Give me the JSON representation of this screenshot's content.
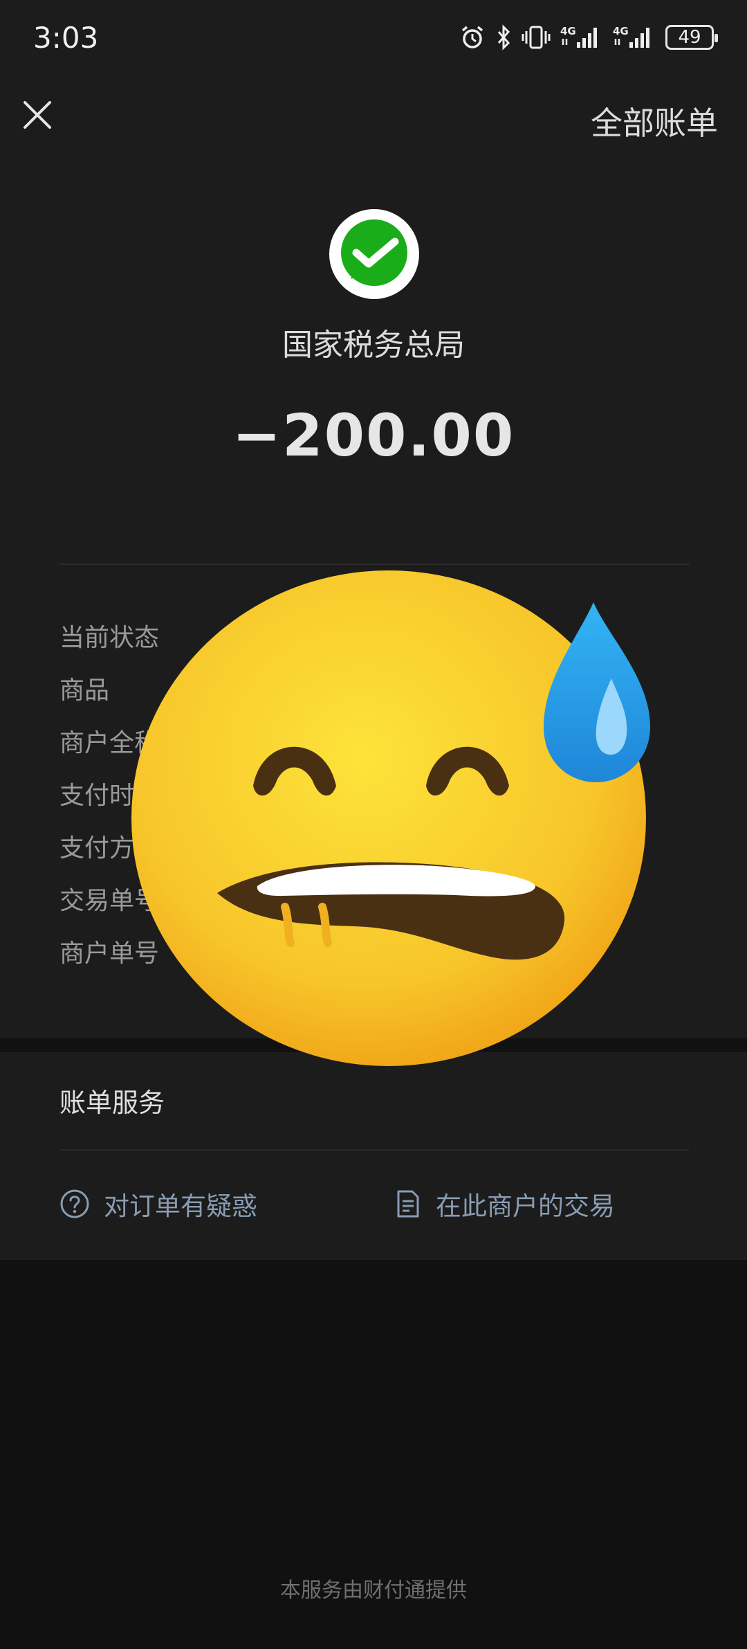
{
  "status_bar": {
    "time": "3:03",
    "battery": "49",
    "icons": [
      "alarm-icon",
      "bluetooth-icon",
      "vibrate-icon",
      "signal-4g-icon",
      "signal-4g-icon",
      "battery-icon"
    ]
  },
  "header": {
    "close_icon": "close-icon",
    "all_bills_label": "全部账单"
  },
  "merchant": {
    "logo_icon": "wechat-pay-icon",
    "name": "国家税务总局",
    "amount": "−200.00"
  },
  "details": {
    "rows": [
      {
        "label": "当前状态"
      },
      {
        "label": "商品"
      },
      {
        "label": "商户全称"
      },
      {
        "label": "支付时间"
      },
      {
        "label": "支付方式"
      },
      {
        "label": "交易单号"
      },
      {
        "label": "商户单号"
      }
    ]
  },
  "services": {
    "title": "账单服务",
    "question_label": "对订单有疑惑",
    "merchant_tx_label": "在此商户的交易"
  },
  "footer": {
    "text": "本服务由财付通提供"
  },
  "colors": {
    "background": "#111111",
    "panel": "#1c1c1c",
    "wechat_green": "#1aad19",
    "link": "#8a9cb3",
    "emoji_yellow": "#f7c72a",
    "sweat_blue": "#2f9be6"
  }
}
